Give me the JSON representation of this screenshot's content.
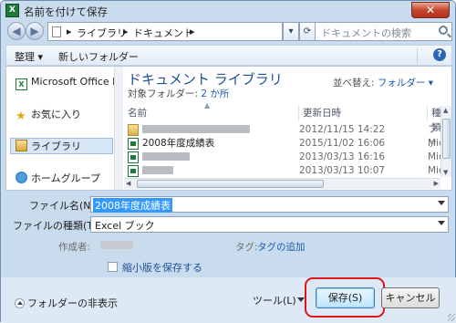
{
  "window": {
    "title": "名前を付けて保存",
    "app_icon": "X",
    "close_glyph": "✕"
  },
  "nav": {
    "back_glyph": "◀",
    "forward_glyph": "▶",
    "breadcrumb_sep": "▸",
    "path": [
      "ライブラリ",
      "ドキュメント"
    ],
    "search_placeholder": "ドキュメントの検索",
    "dropdown_glyph": "▾",
    "refresh_glyph": "⟳"
  },
  "toolbar": {
    "organize": "整理 ▾",
    "new_folder": "新しいフォルダー",
    "help_glyph": "?"
  },
  "sidebar": {
    "items": [
      {
        "label": "Microsoft Office E",
        "icon": "excel-icon"
      },
      {
        "label": "お気に入り",
        "icon": "star-icon"
      },
      {
        "label": "ライブラリ",
        "icon": "library-icon"
      },
      {
        "label": "ホームグループ",
        "icon": "homegroup-icon"
      }
    ]
  },
  "library": {
    "title": "ドキュメント ライブラリ",
    "subtitle_prefix": "対象フォルダー:",
    "subtitle_link": "2 か所",
    "arrange_label": "並べ替え:",
    "arrange_value": "フォルダー ▾"
  },
  "file_list": {
    "columns": {
      "name": "名前",
      "date": "更新日時",
      "type": "種類"
    },
    "sort_glyph": "▲",
    "rows": [
      {
        "name": "",
        "date": "2012/11/15 14:22",
        "type": "ファ",
        "icon": "folder-icon",
        "blurred": true
      },
      {
        "name": "2008年度成績表",
        "date": "2015/11/02 16:06",
        "type": "Mic",
        "icon": "excel-file-icon",
        "blurred": false
      },
      {
        "name": "",
        "date": "2013/03/13 16:16",
        "type": "Mic",
        "icon": "excel-file-icon",
        "blurred": true
      },
      {
        "name": "",
        "date": "2013/03/13 10:07",
        "type": "Mic",
        "icon": "excel-file-icon",
        "blurred": true
      }
    ]
  },
  "form": {
    "filename_label": "ファイル名(N):",
    "filename_value": "2008年度成績表",
    "filetype_label": "ファイルの種類(T):",
    "filetype_value": "Excel ブック",
    "author_label": "作成者:",
    "tags_label": "タグ:",
    "tags_link": "タグの追加",
    "thumbnail_label": "縮小版を保存する"
  },
  "footer": {
    "hide_folders": "フォルダーの非表示",
    "tools": "ツール(L)",
    "save": "保存(S)",
    "cancel": "キャンセル"
  },
  "colors": {
    "accent": "#1c5bb0",
    "highlight_ring": "#e0141b",
    "library_title": "#1e4f97"
  }
}
